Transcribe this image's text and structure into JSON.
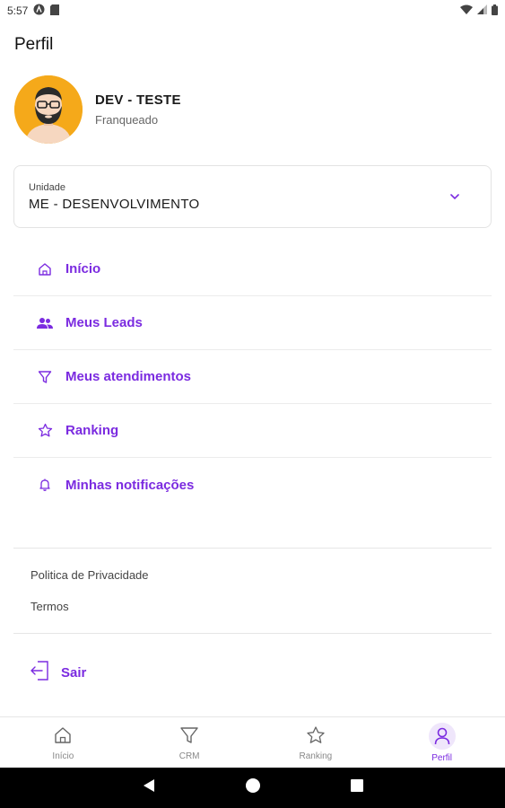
{
  "status_bar": {
    "time": "5:57"
  },
  "app_bar": {
    "title": "Perfil"
  },
  "profile": {
    "name": "DEV - TESTE",
    "role": "Franqueado"
  },
  "unit": {
    "label": "Unidade",
    "value": "ME - DESENVOLVIMENTO"
  },
  "menu": {
    "items": [
      {
        "label": "Início",
        "icon": "home-icon"
      },
      {
        "label": "Meus Leads",
        "icon": "people-icon"
      },
      {
        "label": "Meus atendimentos",
        "icon": "filter-icon"
      },
      {
        "label": "Ranking",
        "icon": "star-icon"
      },
      {
        "label": "Minhas notificações",
        "icon": "bell-icon"
      }
    ]
  },
  "links": {
    "privacy": "Politica de Privacidade",
    "terms": "Termos"
  },
  "logout": {
    "label": "Sair"
  },
  "bottom_nav": {
    "tabs": [
      {
        "label": "Início",
        "icon": "home-icon"
      },
      {
        "label": "CRM",
        "icon": "filter-icon"
      },
      {
        "label": "Ranking",
        "icon": "star-icon"
      },
      {
        "label": "Perfil",
        "icon": "person-icon",
        "active": true
      }
    ]
  },
  "colors": {
    "accent": "#7b2be0",
    "avatar_bg": "#f5a91a",
    "nav_active_bg": "#efe6fb"
  }
}
